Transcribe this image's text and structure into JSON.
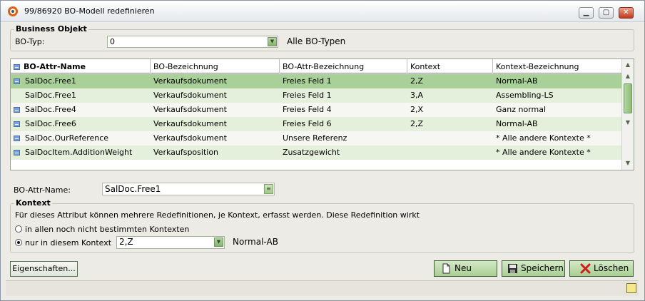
{
  "window": {
    "title": "99/86920 BO-Modell redefinieren",
    "controls": [
      "minimize-icon",
      "maximize-icon",
      "close-icon"
    ]
  },
  "business_objekt": {
    "legend": "Business Objekt",
    "bo_typ_label": "BO-Typ:",
    "bo_typ_value": "0",
    "bo_typ_description": "Alle BO-Typen"
  },
  "grid": {
    "columns": [
      "BO-Attr-Name",
      "BO-Bezeichnung",
      "BO-Attr-Bezeichnung",
      "Kontext",
      "Kontext-Bezeichnung"
    ],
    "rows": [
      {
        "icon": true,
        "cells": [
          "SalDoc.Free1",
          "Verkaufsdokument",
          "Freies Feld 1",
          "2,Z",
          "Normal-AB"
        ],
        "state": "selected"
      },
      {
        "icon": false,
        "cells": [
          "SalDoc.Free1",
          "Verkaufsdokument",
          "Freies Feld 1",
          "3,A",
          "Assembling-LS"
        ],
        "state": "alt"
      },
      {
        "icon": true,
        "cells": [
          "SalDoc.Free4",
          "Verkaufsdokument",
          "Freies Feld 4",
          "2,X",
          "Ganz normal"
        ],
        "state": "plain"
      },
      {
        "icon": true,
        "cells": [
          "SalDoc.Free6",
          "Verkaufsdokument",
          "Freies Feld 6",
          "2,Z",
          "Normal-AB"
        ],
        "state": "alt"
      },
      {
        "icon": true,
        "cells": [
          "SalDoc.OurReference",
          "Verkaufsdokument",
          "Unsere Referenz",
          "",
          "* Alle andere Kontexte *"
        ],
        "state": "plain"
      },
      {
        "icon": true,
        "cells": [
          "SalDocItem.AdditionWeight",
          "Verkaufsposition",
          "Zusatzgewicht",
          "",
          "* Alle andere Kontexte *"
        ],
        "state": "alt"
      }
    ]
  },
  "detail": {
    "attr_name_label": "BO-Attr-Name:",
    "attr_name_value": "SalDoc.Free1"
  },
  "kontext": {
    "legend": "Kontext",
    "info_text": "Für dieses Attribut können mehrere Redefinitionen, je Kontext, erfasst werden. Diese Redefinition wirkt",
    "option_all": "in allen noch nicht bestimmten Kontexten",
    "option_this": "nur in diesem Kontext",
    "selected_option": "this",
    "context_value": "2,Z",
    "context_description": "Normal-AB"
  },
  "buttons": {
    "properties": "Eigenschaften...",
    "new": "Neu",
    "save": "Speichern",
    "delete": "Löschen"
  },
  "colors": {
    "selected_row": "#aad09a",
    "alt_row": "#e4f0dc",
    "button_green": "#a9cf94"
  }
}
